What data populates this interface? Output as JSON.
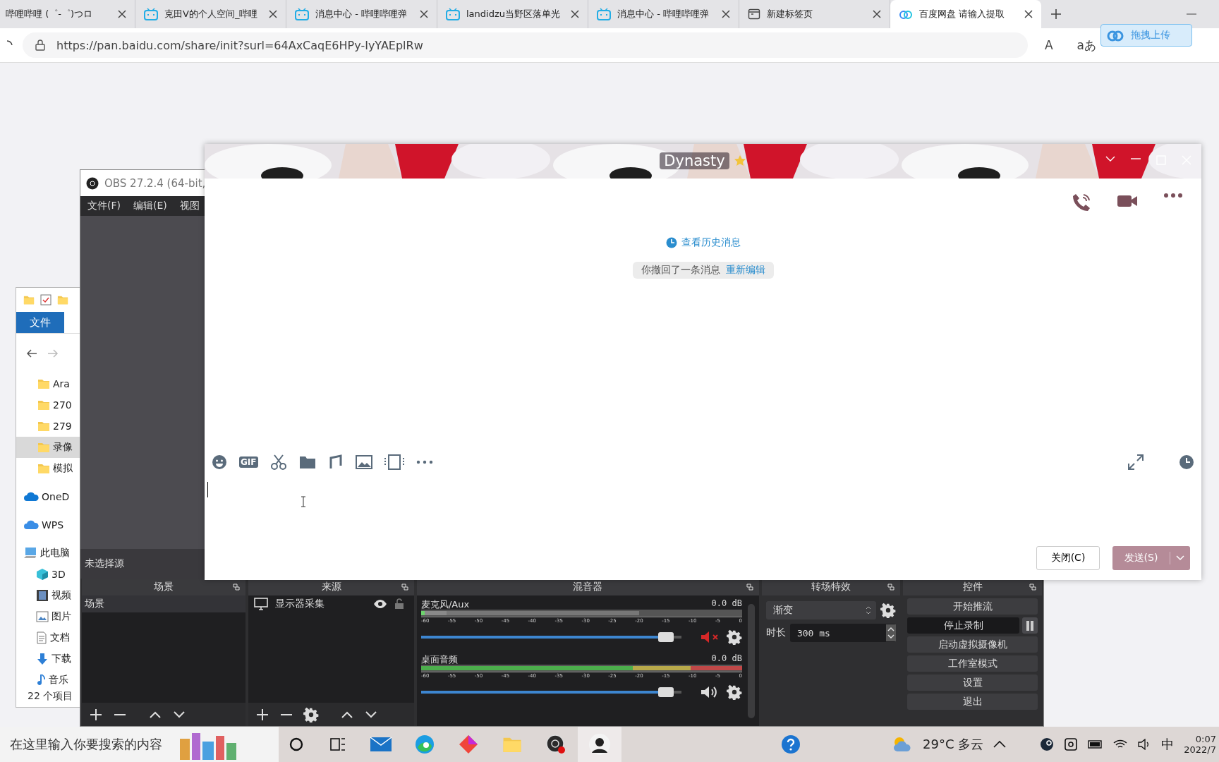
{
  "browser": {
    "tabs": [
      {
        "title": "哔哩哔哩 (゜-゜)つロ",
        "kind": "plain",
        "selected": false
      },
      {
        "title": "克田V的个人空间_哔哩",
        "kind": "bilibili",
        "selected": false
      },
      {
        "title": "消息中心 - 哔哩哔哩弹",
        "kind": "bilibili",
        "selected": false
      },
      {
        "title": "landidzu当野区落单光",
        "kind": "bilibili",
        "selected": false
      },
      {
        "title": "消息中心 - 哔哩哔哩弹",
        "kind": "bilibili",
        "selected": false
      },
      {
        "title": "新建标签页",
        "kind": "newtab",
        "selected": false
      },
      {
        "title": "百度网盘 请输入提取",
        "kind": "baidu",
        "selected": true
      }
    ],
    "url": "https://pan.baidu.com/share/init?surl=64AxCaqE6HPy-IyYAEplRw",
    "read_aloud": "A",
    "translate": "aあ",
    "upload_button": "拖拽上传"
  },
  "explorer": {
    "ribbon_tab": "文件",
    "items": [
      {
        "kind": "folder",
        "label": "Ara",
        "selected": false
      },
      {
        "kind": "folder",
        "label": "270",
        "selected": false
      },
      {
        "kind": "folder",
        "label": "279",
        "selected": false
      },
      {
        "kind": "folder",
        "label": "录像",
        "selected": true
      },
      {
        "kind": "folder",
        "label": "模拟",
        "selected": false
      },
      {
        "kind": "onedrive",
        "label": "OneD",
        "selected": false
      },
      {
        "kind": "wps",
        "label": "WPS",
        "selected": false
      },
      {
        "kind": "pc",
        "label": "此电脑",
        "selected": false
      },
      {
        "kind": "cube",
        "label": "3D",
        "selected": false
      },
      {
        "kind": "video",
        "label": "视频",
        "selected": false
      },
      {
        "kind": "picture",
        "label": "图片",
        "selected": false
      },
      {
        "kind": "doc",
        "label": "文档",
        "selected": false
      },
      {
        "kind": "download",
        "label": "下载",
        "selected": false
      },
      {
        "kind": "music",
        "label": "音乐",
        "selected": false
      }
    ],
    "status": "22 个项目"
  },
  "obs": {
    "title": "OBS 27.2.4 (64-bit,",
    "menu": [
      "文件(F)",
      "编辑(E)",
      "视图"
    ],
    "no_source": "未选择源",
    "scenes": {
      "title": "场景",
      "items": [
        {
          "label": "场景",
          "selected": true
        }
      ]
    },
    "sources": {
      "title": "来源",
      "items": [
        {
          "label": "显示器采集",
          "selected": false
        }
      ]
    },
    "mixer": {
      "title": "混音器",
      "channels": [
        {
          "name": "麦克风/Aux",
          "reading": "0.0 dB",
          "level": 0.97,
          "muted": true,
          "scale": [
            "-60",
            "-55",
            "-50",
            "-45",
            "-40",
            "-35",
            "-30",
            "-25",
            "-20",
            "-15",
            "-10",
            "-5",
            "0"
          ]
        },
        {
          "name": "桌面音频",
          "reading": "0.0 dB",
          "level": 0.97,
          "muted": false,
          "scale": [
            "-60",
            "-55",
            "-50",
            "-45",
            "-40",
            "-35",
            "-30",
            "-25",
            "-20",
            "-15",
            "-10",
            "-5",
            "0"
          ]
        }
      ]
    },
    "transitions": {
      "title": "转场特效",
      "selected": "渐变",
      "duration_label": "时长",
      "duration": "300 ms"
    },
    "controls": {
      "title": "控件",
      "buttons": [
        {
          "label": "开始推流",
          "active": false
        },
        {
          "label": "停止录制",
          "active": true
        },
        {
          "label": "启动虚拟摄像机",
          "active": false
        },
        {
          "label": "工作室模式",
          "active": false
        },
        {
          "label": "设置",
          "active": false
        },
        {
          "label": "退出",
          "active": false
        }
      ]
    }
  },
  "chat": {
    "title": "Dynasty",
    "history_link": "查看历史消息",
    "recall_notice": "你撤回了一条消息",
    "reedit_link": "重新编辑",
    "toolbar_gif": "GIF",
    "close_button": "关闭(C)",
    "send_button": "发送(S)"
  },
  "taskbar": {
    "search_placeholder": "在这里输入你要搜索的内容",
    "apps": [
      {
        "kind": "mail",
        "selected": false
      },
      {
        "kind": "edge",
        "selected": false
      },
      {
        "kind": "diamond",
        "selected": false
      },
      {
        "kind": "files",
        "selected": false
      },
      {
        "kind": "obs",
        "selected": false
      },
      {
        "kind": "avatar",
        "selected": true
      }
    ],
    "weather": "29°C 多云",
    "ime": "中",
    "time": "0:07",
    "date": "2022/7"
  }
}
